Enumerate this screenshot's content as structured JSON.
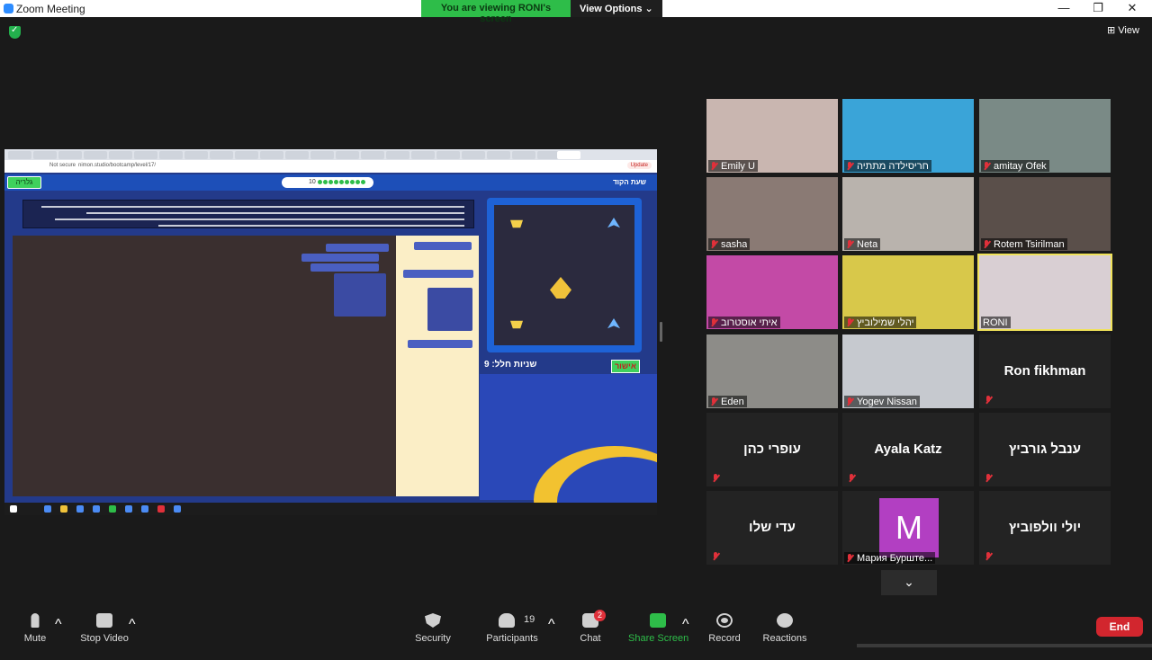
{
  "window": {
    "title": "Zoom Meeting",
    "minimize": "—",
    "maximize": "❐",
    "close": "✕"
  },
  "banner": {
    "message": "You are viewing RONI's screen",
    "options": "View Options ⌄"
  },
  "view_button": "⊞ View",
  "shared_screen": {
    "url": "nimon.studio/bootcamp/level/17/",
    "security_label": "Not secure",
    "update_label": "Update",
    "back_button": "גלריה",
    "game_title": "שעת הקוד",
    "progress_level": "10",
    "stats_label": "שניות חלל: 9",
    "ok_button": "אישור"
  },
  "participants": [
    {
      "name": "Emily U",
      "muted": true,
      "photo": "#c9b6b0"
    },
    {
      "name": "חריסילדה מתתיה",
      "muted": true,
      "photo": "#3aa4d8"
    },
    {
      "name": "amitay Ofek",
      "muted": true,
      "photo": "#7a8a86"
    },
    {
      "name": "sasha",
      "muted": true,
      "photo": "#8a7a74"
    },
    {
      "name": "Neta",
      "muted": true,
      "photo": "#b9b3ad"
    },
    {
      "name": "Rotem Tsirilman",
      "muted": true,
      "photo": "#5a4f4a"
    },
    {
      "name": "איתי אוסטרוב",
      "muted": true,
      "photo": "#c34aa6"
    },
    {
      "name": "יהלי שמילוביץ",
      "muted": true,
      "photo": "#d8c84a"
    },
    {
      "name": "RONI",
      "muted": false,
      "photo": "#d9cfd3"
    },
    {
      "name": "Eden",
      "muted": true,
      "photo": "#8d8c88"
    },
    {
      "name": "Yogev Nissan",
      "muted": true,
      "photo": "#c6c9cf"
    },
    {
      "name": "Ron fikhman",
      "muted": true,
      "photo": ""
    },
    {
      "name": "עופרי כהן",
      "muted": true,
      "photo": ""
    },
    {
      "name": "Ayala Katz",
      "muted": true,
      "photo": ""
    },
    {
      "name": "ענבל גורביץ",
      "muted": true,
      "photo": ""
    },
    {
      "name": "עדי שלו",
      "muted": true,
      "photo": ""
    },
    {
      "name": "Мария Бурште...",
      "muted": true,
      "photo": "",
      "avatar_letter": "M"
    },
    {
      "name": "יולי וולפוביץ",
      "muted": true,
      "photo": ""
    }
  ],
  "scroll_down": "⌄",
  "toolbar": {
    "mute": "Mute",
    "stop_video": "Stop Video",
    "security": "Security",
    "participants": "Participants",
    "participants_count": "19",
    "chat": "Chat",
    "chat_badge": "2",
    "share_screen": "Share Screen",
    "record": "Record",
    "reactions": "Reactions",
    "end": "End",
    "caret": "^"
  }
}
